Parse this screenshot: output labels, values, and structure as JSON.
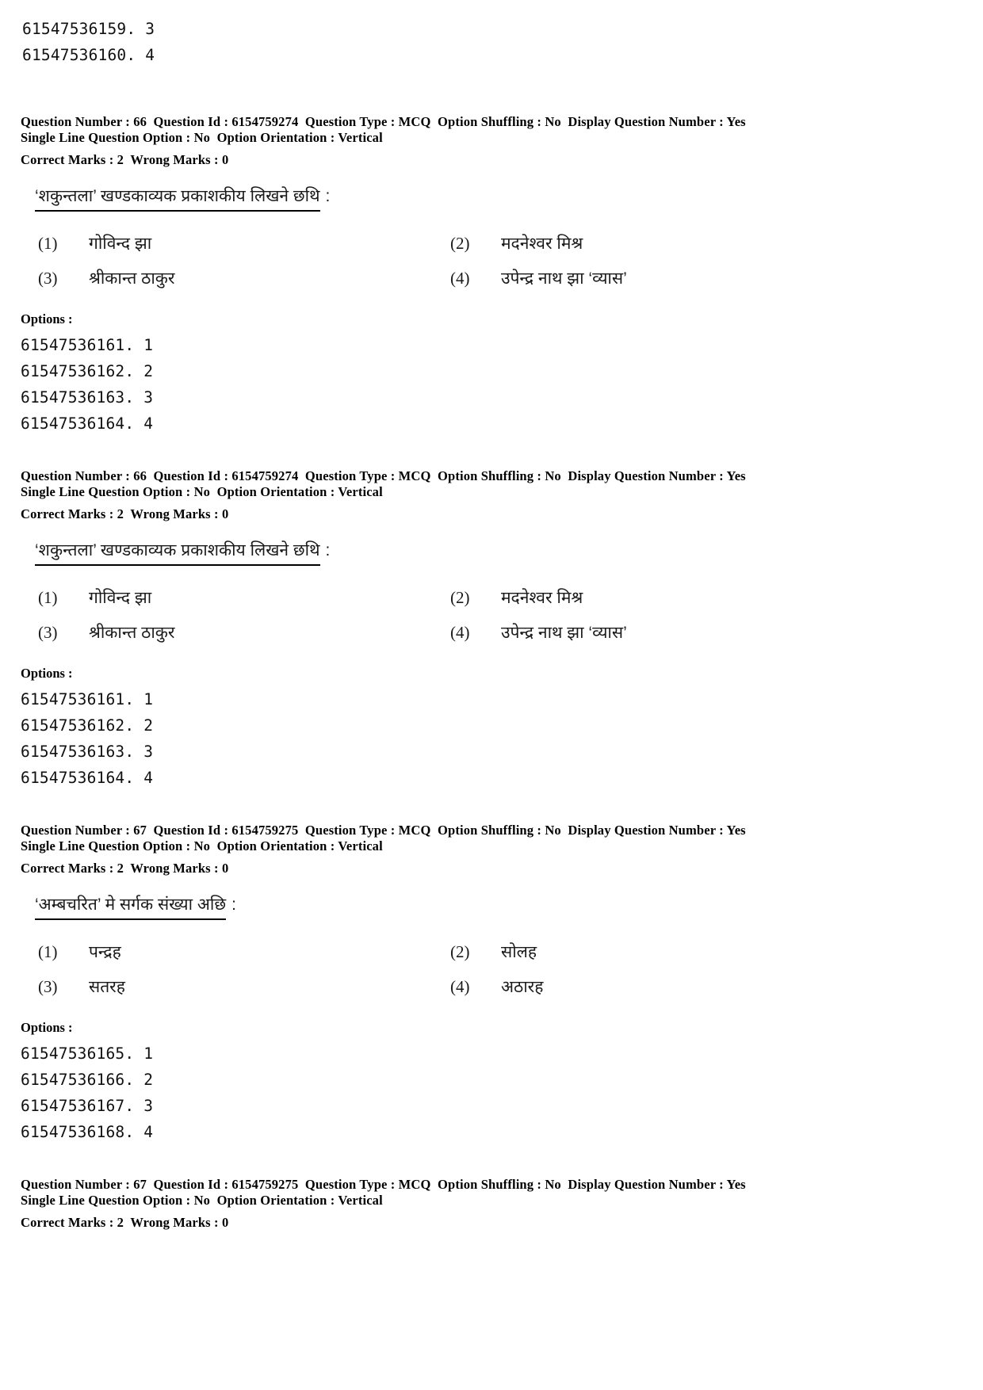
{
  "page": {
    "top_option_ids": [
      "61547536159. 3",
      "61547536160. 4"
    ]
  },
  "questions": [
    {
      "meta_line_1": "Question Number : 66  Question Id : 6154759274  Question Type : MCQ  Option Shuffling : No  Display Question Number : Yes",
      "meta_line_2": "Single Line Question Option : No  Option Orientation : Vertical",
      "meta_line_3": "Correct Marks : 2  Wrong Marks : 0",
      "question_number": "66",
      "question_id": "6154759274",
      "question_type": "MCQ",
      "option_shuffling": "No",
      "display_question_number": "Yes",
      "single_line_question_option": "No",
      "option_orientation": "Vertical",
      "correct_marks": "2",
      "wrong_marks": "0",
      "question_text_underlined": "‘शकुन्तला’ खण्डकाव्यक प्रकाशकीय लिखने छथि",
      "question_text_tail": ":",
      "choices": [
        {
          "num": "(1)",
          "text": "गोविन्द झा"
        },
        {
          "num": "(2)",
          "text": "मदनेश्वर मिश्र"
        },
        {
          "num": "(3)",
          "text": "श्रीकान्त ठाकुर"
        },
        {
          "num": "(4)",
          "text": "उपेन्द्र नाथ झा ‘व्यास’"
        }
      ],
      "options_label": "Options :",
      "option_ids": [
        "61547536161. 1",
        "61547536162. 2",
        "61547536163. 3",
        "61547536164. 4"
      ]
    },
    {
      "meta_line_1": "Question Number : 66  Question Id : 6154759274  Question Type : MCQ  Option Shuffling : No  Display Question Number : Yes",
      "meta_line_2": "Single Line Question Option : No  Option Orientation : Vertical",
      "meta_line_3": "Correct Marks : 2  Wrong Marks : 0",
      "question_number": "66",
      "question_id": "6154759274",
      "question_type": "MCQ",
      "option_shuffling": "No",
      "display_question_number": "Yes",
      "single_line_question_option": "No",
      "option_orientation": "Vertical",
      "correct_marks": "2",
      "wrong_marks": "0",
      "question_text_underlined": "‘शकुन्तला’ खण्डकाव्यक प्रकाशकीय लिखने छथि",
      "question_text_tail": ":",
      "choices": [
        {
          "num": "(1)",
          "text": "गोविन्द झा"
        },
        {
          "num": "(2)",
          "text": "मदनेश्वर मिश्र"
        },
        {
          "num": "(3)",
          "text": "श्रीकान्त ठाकुर"
        },
        {
          "num": "(4)",
          "text": "उपेन्द्र नाथ झा ‘व्यास’"
        }
      ],
      "options_label": "Options :",
      "option_ids": [
        "61547536161. 1",
        "61547536162. 2",
        "61547536163. 3",
        "61547536164. 4"
      ]
    },
    {
      "meta_line_1": "Question Number : 67  Question Id : 6154759275  Question Type : MCQ  Option Shuffling : No  Display Question Number : Yes",
      "meta_line_2": "Single Line Question Option : No  Option Orientation : Vertical",
      "meta_line_3": "Correct Marks : 2  Wrong Marks : 0",
      "question_number": "67",
      "question_id": "6154759275",
      "question_type": "MCQ",
      "option_shuffling": "No",
      "display_question_number": "Yes",
      "single_line_question_option": "No",
      "option_orientation": "Vertical",
      "correct_marks": "2",
      "wrong_marks": "0",
      "question_text_underlined": "‘अम्बचरित’ मे सर्गक संख्या अछि",
      "question_text_tail": ":",
      "choices": [
        {
          "num": "(1)",
          "text": "पन्द्रह"
        },
        {
          "num": "(2)",
          "text": "सोलह"
        },
        {
          "num": "(3)",
          "text": "सतरह"
        },
        {
          "num": "(4)",
          "text": "अठारह"
        }
      ],
      "options_label": "Options :",
      "option_ids": [
        "61547536165. 1",
        "61547536166. 2",
        "61547536167. 3",
        "61547536168. 4"
      ]
    },
    {
      "meta_line_1": "Question Number : 67  Question Id : 6154759275  Question Type : MCQ  Option Shuffling : No  Display Question Number : Yes",
      "meta_line_2": "Single Line Question Option : No  Option Orientation : Vertical",
      "meta_line_3": "Correct Marks : 2  Wrong Marks : 0",
      "question_number": "67",
      "question_id": "6154759275",
      "question_type": "MCQ",
      "option_shuffling": "No",
      "display_question_number": "Yes",
      "single_line_question_option": "No",
      "option_orientation": "Vertical",
      "correct_marks": "2",
      "wrong_marks": "0"
    }
  ]
}
